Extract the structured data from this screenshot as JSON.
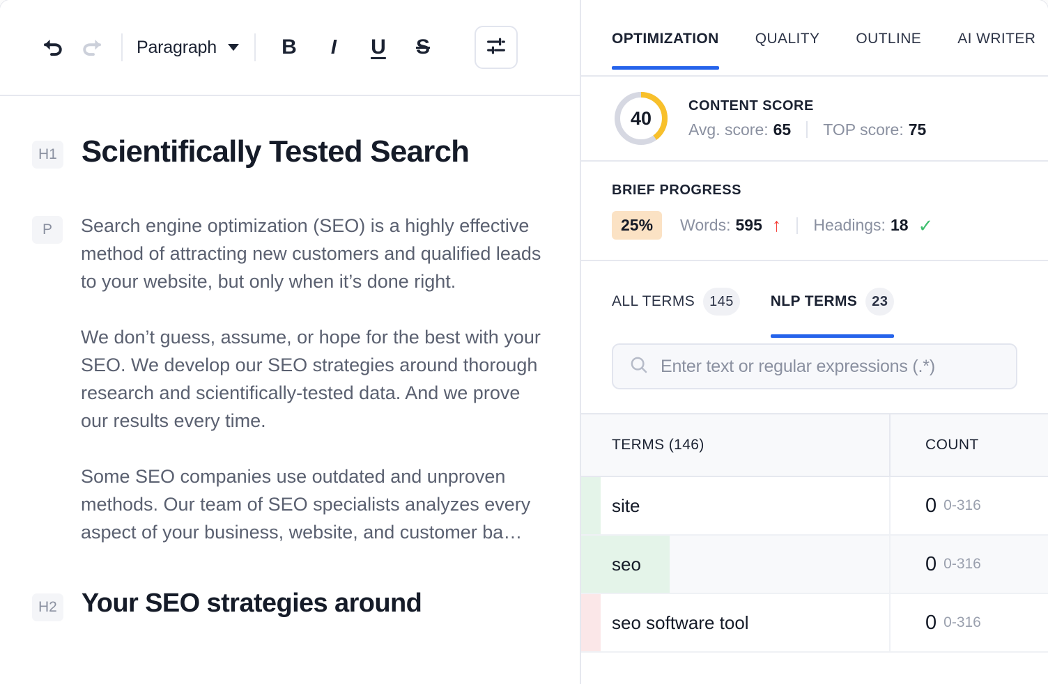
{
  "editor": {
    "toolbar": {
      "undo": "undo-icon",
      "redo": "redo-icon",
      "style_select": "Paragraph",
      "bold": "B",
      "italic": "I",
      "underline": "U",
      "strikethrough": "S",
      "settings": "sliders-icon"
    },
    "blocks": [
      {
        "tag": "H1",
        "type": "heading1",
        "text": "Scientifically Tested Search"
      },
      {
        "tag": "P",
        "type": "paragraph",
        "paragraphs": [
          "Search engine optimization (SEO) is a highly effective method of attracting new customers and qualified leads to your website, but only when it’s done right.",
          "We don’t guess, assume, or hope for the best with your SEO. We develop our SEO strategies around thorough research and scientifically-tested data. And we prove our results every time.",
          "Some SEO companies use outdated and unproven methods. Our team of SEO specialists analyzes every aspect of your business, website, and customer ba…"
        ]
      },
      {
        "tag": "H2",
        "type": "heading2",
        "text": "Your SEO strategies around"
      }
    ]
  },
  "panel": {
    "tabs": [
      {
        "label": "OPTIMIZATION",
        "active": true
      },
      {
        "label": "QUALITY",
        "active": false
      },
      {
        "label": "OUTLINE",
        "active": false
      },
      {
        "label": "AI WRITER",
        "active": false
      }
    ],
    "content_score": {
      "title": "CONTENT SCORE",
      "value": "40",
      "percent": 40,
      "avg_label": "Avg. score:",
      "avg_value": "65",
      "top_label": "TOP score:",
      "top_value": "75",
      "ring_color": "#F8C02B",
      "ring_track_color": "#D6D8E2"
    },
    "brief_progress": {
      "title": "BRIEF PROGRESS",
      "percent_badge": "25%",
      "badge_color": "#FBE2C4",
      "words_label": "Words:",
      "words_value": "595",
      "words_status_icon": "arrow-up-icon",
      "words_status_color": "#F5413B",
      "headings_label": "Headings:",
      "headings_value": "18",
      "headings_status_icon": "check-icon",
      "headings_status_color": "#3FBF6F"
    },
    "term_tabs": [
      {
        "label": "ALL TERMS",
        "count": "145",
        "active": false
      },
      {
        "label": "NLP TERMS",
        "count": "23",
        "active": true
      }
    ],
    "search": {
      "placeholder": "Enter text or regular expressions (.*)",
      "value": "",
      "icon": "search-icon"
    },
    "table": {
      "columns": [
        {
          "key": "terms",
          "label": "TERMS (146)"
        },
        {
          "key": "count",
          "label": "COUNT"
        }
      ],
      "rows": [
        {
          "term": "site",
          "count": "0",
          "range": "0-316",
          "strip": "green",
          "strip_wide": false,
          "hover": false
        },
        {
          "term": "seo",
          "count": "0",
          "range": "0-316",
          "strip": "green",
          "strip_wide": true,
          "hover": true
        },
        {
          "term": "seo software tool",
          "count": "0",
          "range": "0-316",
          "strip": "red",
          "strip_wide": false,
          "hover": false
        }
      ]
    }
  },
  "colors": {
    "accent": "#2563EB",
    "text_dark": "#151B28",
    "text_muted": "#8A90A0",
    "border": "#E6E8EF",
    "green_strip": "#E4F4E9",
    "red_strip": "#FBE7E8"
  }
}
